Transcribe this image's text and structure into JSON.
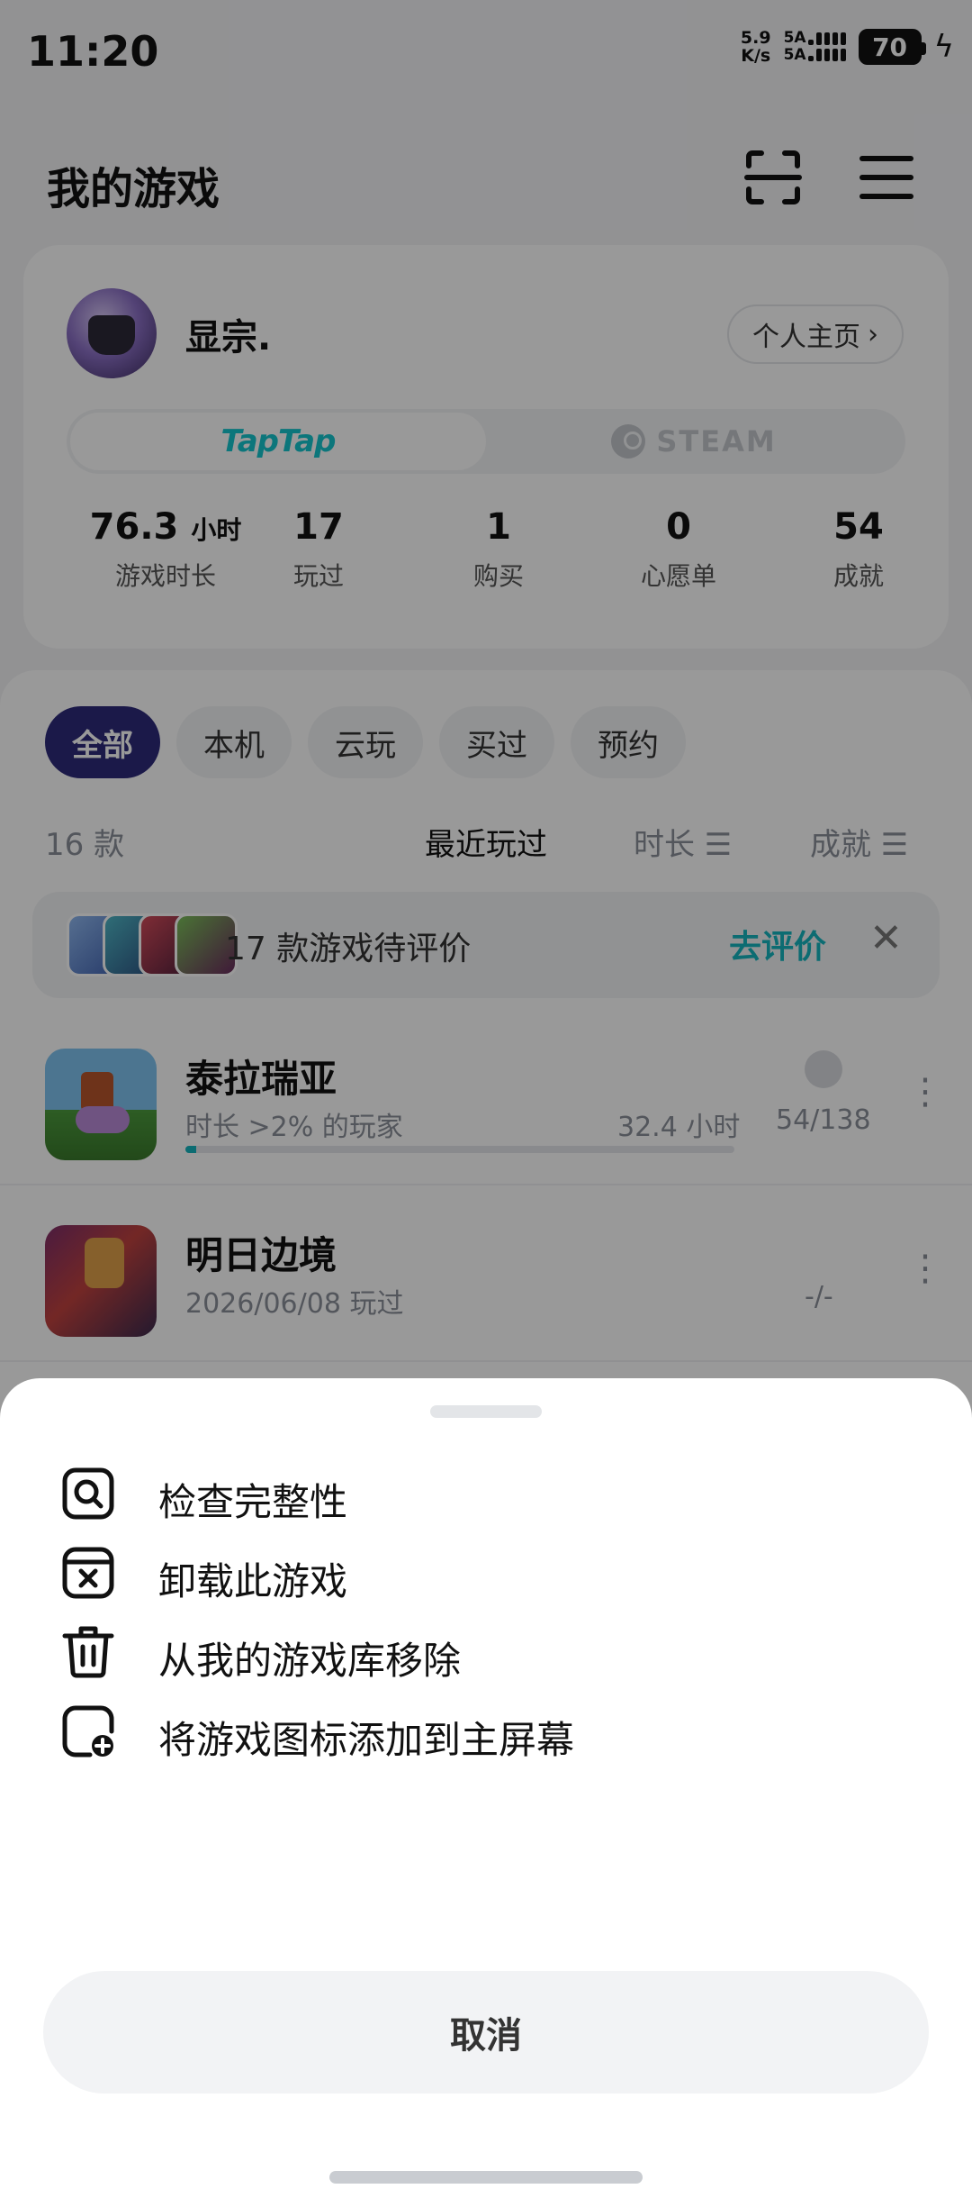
{
  "status": {
    "time": "11:20",
    "net_speed_top": "5.9",
    "net_speed_bottom": "K/s",
    "sim1": "5A",
    "sim2": "5A",
    "battery": "70"
  },
  "header": {
    "title": "我的游戏"
  },
  "profile": {
    "name": "显宗.",
    "profile_button": "个人主页",
    "platforms": [
      "TapTap",
      "STEAM"
    ],
    "stats": [
      {
        "value": "76.3",
        "unit": "小时",
        "label": "游戏时长"
      },
      {
        "value": "17",
        "unit": "",
        "label": "玩过"
      },
      {
        "value": "1",
        "unit": "",
        "label": "购买"
      },
      {
        "value": "0",
        "unit": "",
        "label": "心愿单"
      },
      {
        "value": "54",
        "unit": "",
        "label": "成就"
      }
    ]
  },
  "filters": [
    "全部",
    "本机",
    "云玩",
    "买过",
    "预约"
  ],
  "sort": {
    "count": "16 款",
    "recent": "最近玩过",
    "duration": "时长 ☰",
    "achievement": "成就 ☰"
  },
  "review_banner": {
    "text": "17 款游戏待评价",
    "action": "去评价",
    "close": "✕"
  },
  "games": [
    {
      "name": "泰拉瑞亚",
      "sub": "时长 >2% 的玩家",
      "hours": "32.4 小时",
      "achievements": "54/138",
      "progress": 0.02
    },
    {
      "name": "明日边境",
      "sub": "2026/06/08 玩过",
      "hours": "",
      "achievements": "-/-",
      "progress": null
    }
  ],
  "sheet": {
    "items": [
      {
        "label": "检查完整性",
        "icon": "search-square-icon"
      },
      {
        "label": "卸载此游戏",
        "icon": "uninstall-icon"
      },
      {
        "label": "从我的游戏库移除",
        "icon": "trash-icon"
      },
      {
        "label": "将游戏图标添加到主屏幕",
        "icon": "add-to-home-icon"
      }
    ],
    "cancel": "取消"
  },
  "colors": {
    "accent": "#15b5be",
    "chip_active": "#2e2a7a",
    "taptap": "#15c5ce"
  }
}
